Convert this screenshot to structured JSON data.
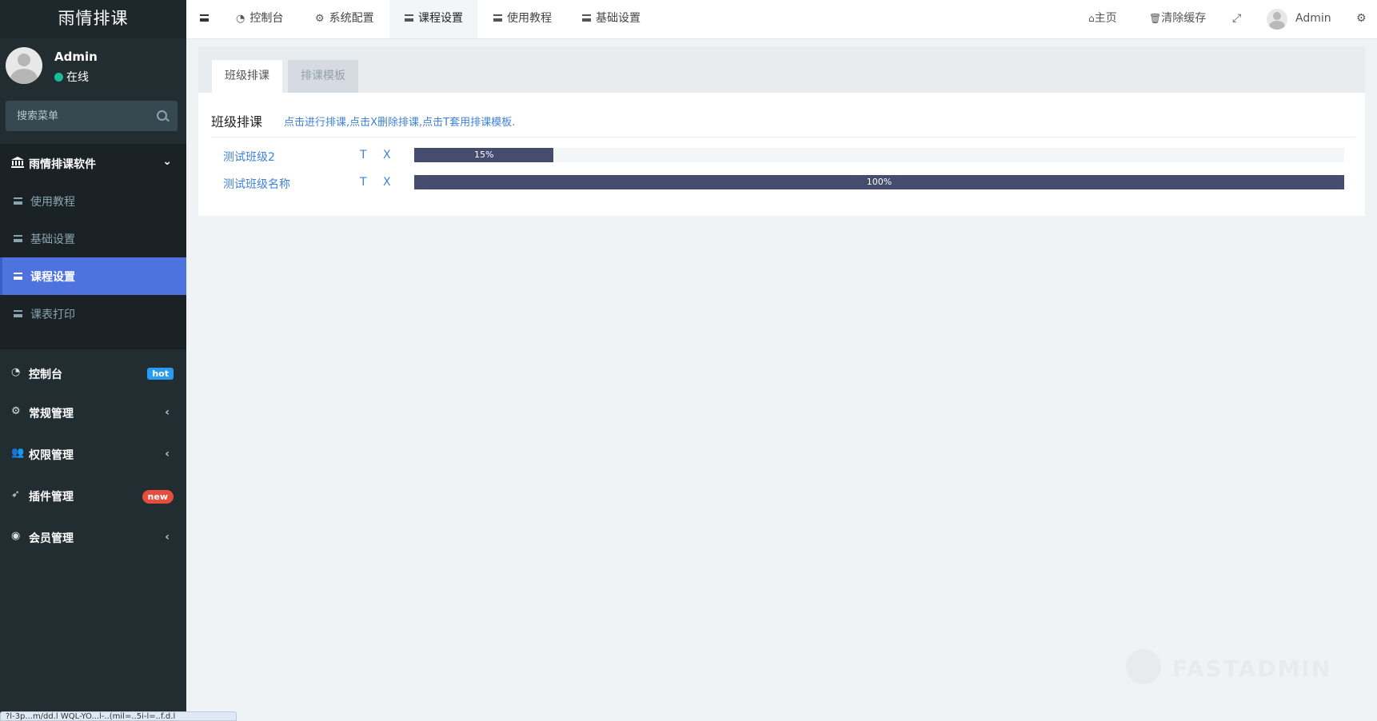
{
  "app": {
    "title": "雨情排课"
  },
  "user": {
    "name": "Admin",
    "status": "在线"
  },
  "sidebar": {
    "search_placeholder": "搜索菜单",
    "group": {
      "label": "雨情排课软件",
      "items": [
        {
          "label": "使用教程"
        },
        {
          "label": "基础设置"
        },
        {
          "label": "课程设置",
          "active": true
        },
        {
          "label": "课表打印"
        }
      ]
    },
    "main_items": [
      {
        "label": "控制台",
        "badge": "hot"
      },
      {
        "label": "常规管理"
      },
      {
        "label": "权限管理"
      },
      {
        "label": "插件管理",
        "badge": "new"
      },
      {
        "label": "会员管理"
      }
    ]
  },
  "topbar": {
    "tabs": [
      {
        "label": "控制台",
        "icon": "dashboard-icon"
      },
      {
        "label": "系统配置",
        "icon": "gear-icon"
      },
      {
        "label": "课程设置",
        "icon": "bars-icon",
        "active": true
      },
      {
        "label": "使用教程",
        "icon": "bars-icon"
      },
      {
        "label": "基础设置",
        "icon": "bars-icon"
      }
    ],
    "home_label": "主页",
    "clear_cache_label": "清除缓存",
    "user_label": "Admin"
  },
  "content": {
    "tabs": [
      {
        "label": "班级排课",
        "active": true
      },
      {
        "label": "排课模板"
      }
    ],
    "section_title": "班级排课",
    "hint": "点击进行排课,点击X删除排课,点击T套用排课模板.",
    "rows": [
      {
        "name": "测试班级2",
        "t": "T",
        "x": "X",
        "progress_label": "15%",
        "progress": 0.15
      },
      {
        "name": "测试班级名称",
        "t": "T",
        "x": "X",
        "progress_label": "100%",
        "progress": 1.0
      }
    ]
  },
  "watermark": "FASTADMIN",
  "statusbar": "?l-3p...m/dd.l WQL-YO...l-..(mil=..5i-l=..f.d.l",
  "colors": {
    "sidebar": "#222d32",
    "active": "#4e73df",
    "link": "#3f82d8",
    "progress": "#454c6e",
    "online": "#18bc9c"
  }
}
